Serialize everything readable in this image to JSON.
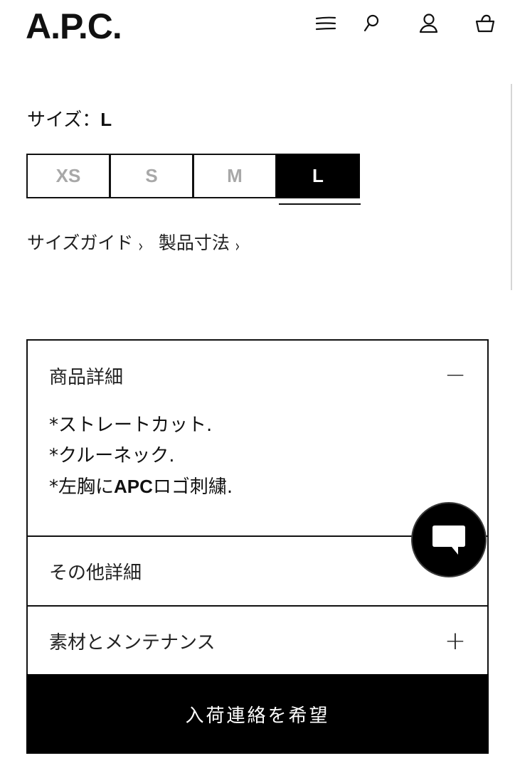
{
  "header": {
    "logo": "A.P.C.",
    "icons": [
      "menu-icon",
      "search-icon",
      "account-icon",
      "bag-icon"
    ]
  },
  "size": {
    "label": "サイズ：",
    "selected": "L",
    "options": [
      "XS",
      "S",
      "M",
      "L"
    ]
  },
  "links": {
    "size_guide": "サイズガイド",
    "dimensions": "製品寸法",
    "chevron": "›"
  },
  "accordion": {
    "details": {
      "title": "商品詳細",
      "toggle": "−",
      "lines": [
        "*ストレートカット.",
        "*クルーネック."
      ],
      "line3_pre": "*左胸に",
      "line3_bold": "APC",
      "line3_post": "ロゴ刺繍."
    },
    "other": {
      "title": "その他詳細"
    },
    "material": {
      "title": "素材とメンテナンス",
      "toggle": "+"
    }
  },
  "cta": {
    "label": "入荷連絡を希望"
  },
  "colors": {
    "primary": "#000000",
    "unselected_size_text": "#a8a8a8"
  }
}
